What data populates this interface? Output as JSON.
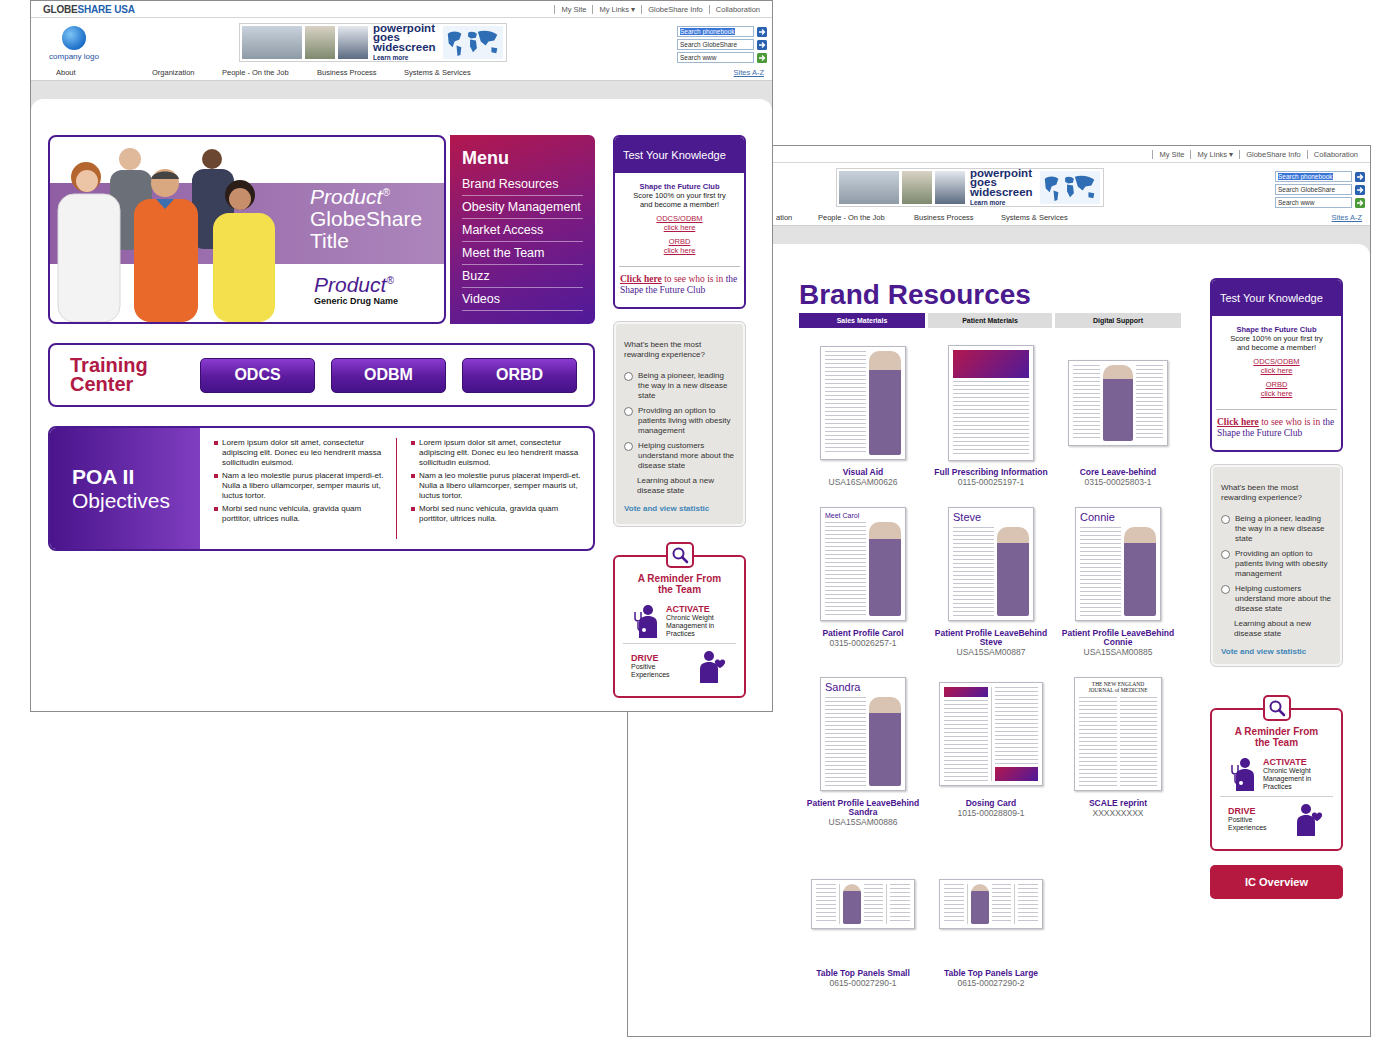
{
  "sidebar": {
    "quiz": {
      "title": "Test Your Knowledge",
      "club": "Shape the Future Club",
      "blurb": "Score 100% on your first try and become a member!",
      "links": [
        {
          "label": "ODCS/ODBM",
          "action": "click here"
        },
        {
          "label": "ORBD",
          "action": "click here"
        }
      ],
      "footer": {
        "link": "Click here",
        "text": " to see who is in ",
        "emphasis": "the Shape the Future Club"
      }
    },
    "poll": {
      "question": "What's been the most rewarding experience?",
      "options": [
        {
          "label": "Being a pioneer, leading the way in a new disease state",
          "kind": "radio",
          "selected": false
        },
        {
          "label": "Providing an option to patients living with obesity management",
          "kind": "radio",
          "selected": false
        },
        {
          "label": "Helping customers understand more about the disease state",
          "kind": "radio",
          "selected": false
        },
        {
          "label": "Learning about a new disease state",
          "kind": "plain",
          "selected": false
        }
      ],
      "vote": "Vote and view statistic"
    },
    "reminder": {
      "title": "A Reminder From the Team",
      "items": [
        {
          "verb": "ACTIVATE",
          "detail": "Chronic Weight Management in Practices",
          "kind": "stethoscope"
        },
        {
          "verb": "DRIVE",
          "detail": "Positive Experiences",
          "kind": "heart"
        }
      ]
    }
  },
  "home_window": {
    "brand": [
      {
        "text": "GLOBE",
        "color": "#3d3d3d"
      },
      {
        "text": "SHARE USA",
        "color": "#1f5fae"
      }
    ],
    "top_links": [
      "My Site",
      "My Links ▾",
      "GlobeShare Info",
      "Collaboration"
    ],
    "logo": {
      "caption": "company logo"
    },
    "banner": {
      "lines": [
        "powerpoint",
        "goes",
        "widescreen"
      ],
      "cta": "Learn more"
    },
    "search": [
      {
        "placeholder": "Search phonebook",
        "highlighted": true,
        "color": "#2a62b0"
      },
      {
        "placeholder": "Search GlobeShare",
        "highlighted": false,
        "color": "#2a62b0"
      },
      {
        "placeholder": "Search www",
        "highlighted": false,
        "color": "#4c9a3a"
      }
    ],
    "nav": [
      "About",
      "Organization",
      "People - On the Job",
      "Business Process",
      "Systems & Services"
    ],
    "sites": "Sites A-Z",
    "hero": {
      "product": "Product",
      "mark": "®",
      "title_lines": [
        "GlobeShare",
        "Title"
      ],
      "generic": "Generic Drug Name"
    },
    "menu": {
      "title": "Menu",
      "items": [
        "Brand Resources",
        "Obesity Management",
        "Market Access",
        "Meet the Team",
        "Buzz",
        "Videos"
      ]
    },
    "training": {
      "title": "Training Center",
      "buttons": [
        "ODCS",
        "ODBM",
        "ORBD"
      ]
    },
    "objectives": {
      "title": "POA II",
      "subtitle": "Objectives",
      "columns": [
        [
          "Lorem ipsum dolor sit amet, consectetur adipiscing elit. Donec eu leo hendrerit massa sollicitudin euismod.",
          "Nam a leo molestie purus placerat imperdi-et. Nulla a libero ullamcorper, semper mauris ut, luctus tortor.",
          "Morbi sed nunc vehicula, gravida quam porttitor, ultrices nulla."
        ],
        [
          "Lorem ipsum dolor sit amet, consectetur adipiscing elit. Donec eu leo hendrerit massa sollicitudin euismod.",
          "Nam a leo molestie purus placerat imperdi-et. Nulla a libero ullamcorper, semper mauris ut, luctus tortor.",
          "Morbi sed nunc vehicula, gravida quam porttitor, ultrices nulla."
        ]
      ]
    }
  },
  "brand_window": {
    "top_links": [
      "My Site",
      "My Links ▾",
      "GlobeShare Info",
      "Collaboration"
    ],
    "banner": {
      "lines": [
        "powerpoint",
        "goes",
        "widescreen"
      ],
      "cta": "Learn more"
    },
    "search": [
      {
        "placeholder": "Search phonebook",
        "highlighted": true,
        "color": "#2a62b0"
      },
      {
        "placeholder": "Search GlobeShare",
        "highlighted": false,
        "color": "#2a62b0"
      },
      {
        "placeholder": "Search www",
        "highlighted": false,
        "color": "#4c9a3a"
      }
    ],
    "nav": [
      "ation",
      "People - On the Job",
      "Business Process",
      "Systems & Services"
    ],
    "sites": "Sites A-Z",
    "title": "Brand Resources",
    "tabs": [
      {
        "label": "Sales Materials",
        "selected": true
      },
      {
        "label": "Patient Materials",
        "selected": false
      },
      {
        "label": "Digital Support",
        "selected": false
      }
    ],
    "documents": [
      {
        "name": "Visual Aid",
        "code": "USA16SAM00626",
        "kind": "profile"
      },
      {
        "name": "Full Prescribing Information",
        "code": "0115-00025197-1",
        "kind": "cover"
      },
      {
        "name": "Core Leave-behind",
        "code": "0315-00025803-1",
        "kind": "landscape"
      },
      {
        "name": "Patient Profile Carol",
        "code": "0315-00026257-1",
        "kind": "profile",
        "heading": "Meet Carol"
      },
      {
        "name": "Patient Profile LeaveBehind Steve",
        "code": "USA15SAM00887",
        "kind": "profile",
        "heading": "Steve"
      },
      {
        "name": "Patient Profile LeaveBehind Connie",
        "code": "USA15SAM00885",
        "kind": "profile",
        "heading": "Connie"
      },
      {
        "name": "Patient Profile LeaveBehind Sandra",
        "code": "USA15SAM00886",
        "kind": "profile",
        "heading": "Sandra"
      },
      {
        "name": "Dosing Card",
        "code": "1015-00028809-1",
        "kind": "spread"
      },
      {
        "name": "SCALE reprint",
        "code": "XXXXXXXXX",
        "kind": "article",
        "heading": "THE NEW ENGLAND JOURNAL of MEDICINE"
      },
      {
        "name": "Table Top Panels Small",
        "code": "0615-00027290-1",
        "kind": "panel"
      },
      {
        "name": "Table Top Panels Large",
        "code": "0615-00027290-2",
        "kind": "panel"
      }
    ],
    "ic_button": "IC Overview"
  }
}
